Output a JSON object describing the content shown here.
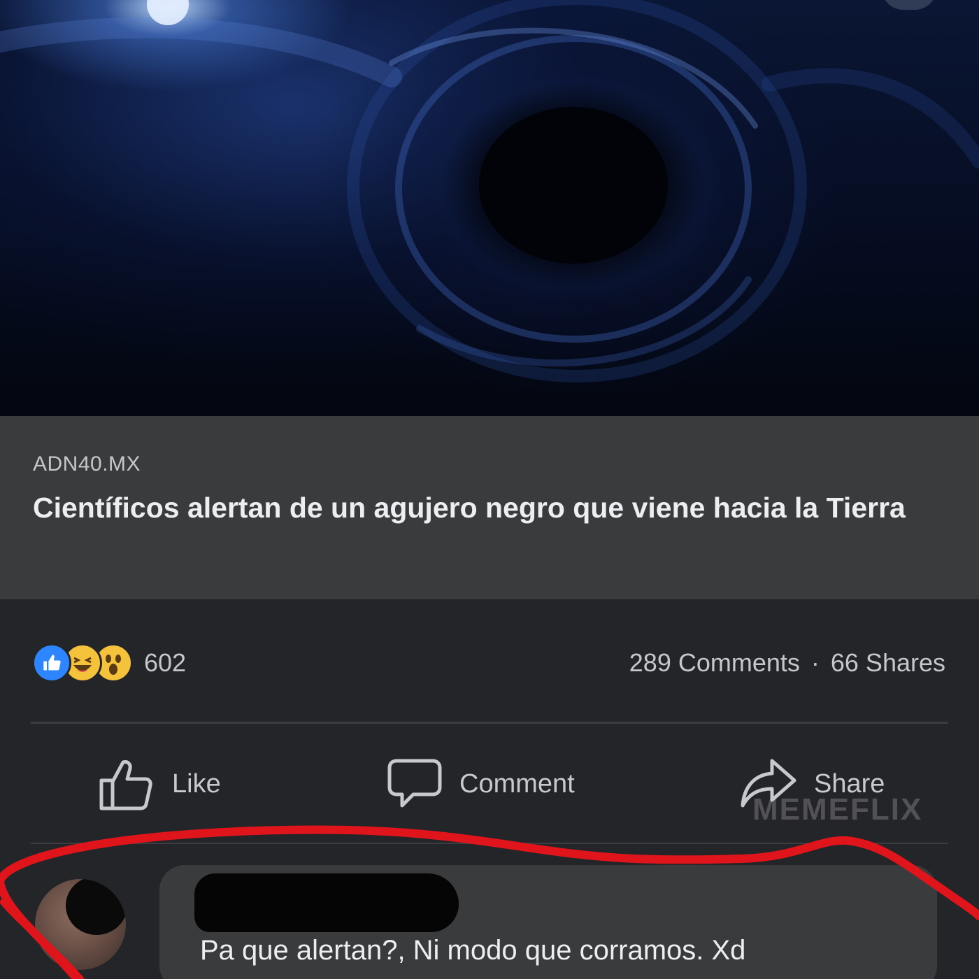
{
  "post": {
    "image_alt": "black-hole-space-image",
    "link": {
      "domain": "ADN40.MX",
      "title": "Científicos alertan de un agujero negro que viene hacia la Tierra"
    },
    "stats": {
      "reaction_icons": [
        "like-icon",
        "haha-icon",
        "wow-icon"
      ],
      "reactions_count": "602",
      "comments_label": "289 Comments",
      "separator": "·",
      "shares_label": "66 Shares"
    },
    "actions": {
      "like_label": "Like",
      "comment_label": "Comment",
      "share_label": "Share"
    },
    "watermark": "MEMEFLIX"
  },
  "comment": {
    "text": "Pa que alertan?, Ni modo que corramos. Xd"
  },
  "colors": {
    "background": "#242529",
    "link_box": "#3a3b3d",
    "text_primary": "#eceef1",
    "text_secondary": "#c6c7cb",
    "like_blue": "#2d86ff",
    "highlight_red": "#e0141b"
  }
}
